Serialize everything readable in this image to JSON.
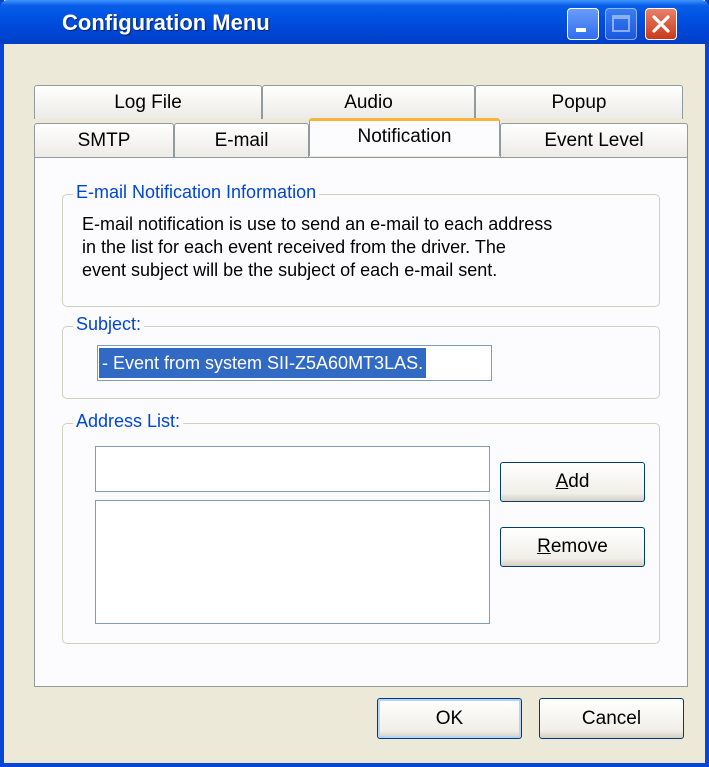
{
  "window": {
    "title": "Configuration Menu"
  },
  "titlebar_buttons": {
    "minimize": "minimize-icon",
    "maximize": "maximize-icon",
    "close": "close-icon"
  },
  "tabs": {
    "row1": [
      "Log File",
      "Audio",
      "Popup"
    ],
    "row2": [
      "SMTP",
      "E-mail",
      "Notification",
      "Event Level"
    ],
    "active": "Notification"
  },
  "info_group": {
    "legend": "E-mail Notification Information",
    "line1": "E-mail notification is use to send an e-mail to each address",
    "line2": "in the list for each event received from the driver. The",
    "line3": "event subject will be the subject of each e-mail sent."
  },
  "subject_group": {
    "legend": "Subject:",
    "value": "- Event from system SII-Z5A60MT3LAS."
  },
  "address_group": {
    "legend": "Address List:",
    "input_value": "",
    "list_items": [],
    "add_button": {
      "accel": "A",
      "rest": "dd"
    },
    "remove_button": {
      "accel": "R",
      "rest": "emove"
    }
  },
  "footer": {
    "ok_label": "OK",
    "cancel_label": "Cancel"
  },
  "colors": {
    "titlebar": "#0055e5",
    "legend_text": "#0046d5",
    "selection": "#316ac5",
    "active_tab_accent": "#f8b33a"
  }
}
